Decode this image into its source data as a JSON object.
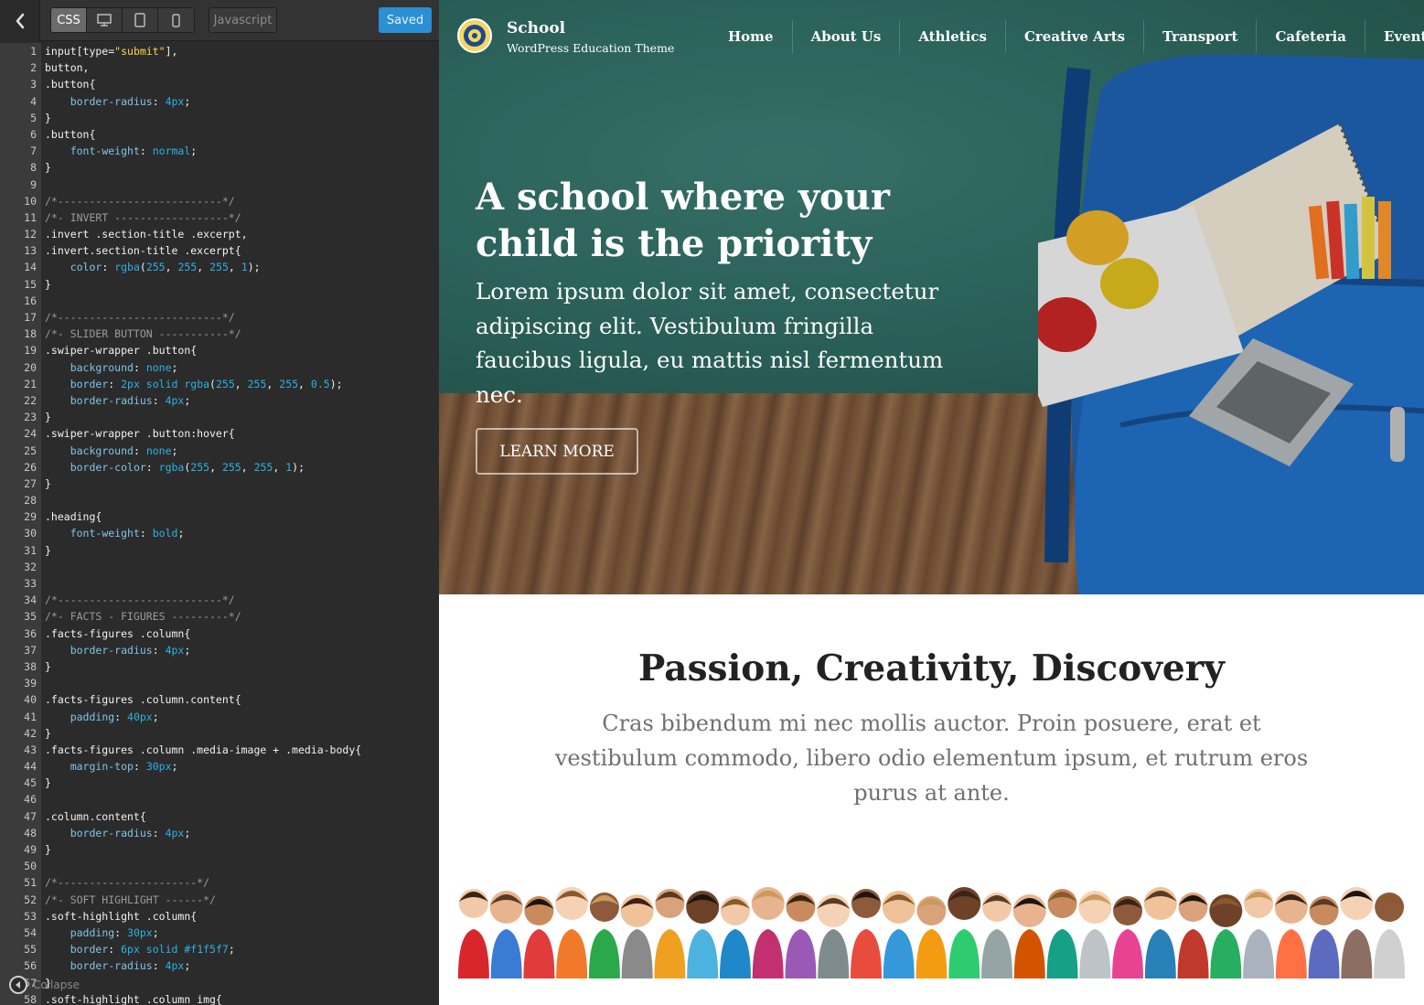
{
  "editor": {
    "tabs": {
      "css": "CSS",
      "javascript": "Javascript"
    },
    "saved_label": "Saved",
    "collapse_label": "Collapse",
    "code_lines": [
      [
        [
          "p",
          "input[type="
        ],
        [
          "s",
          "\"submit\""
        ],
        [
          "p",
          "],"
        ]
      ],
      [
        [
          "p",
          "button,"
        ]
      ],
      [
        [
          "p",
          ".button{"
        ]
      ],
      [
        [
          "p",
          "    "
        ],
        [
          "k",
          "border-radius"
        ],
        [
          "p",
          ": "
        ],
        [
          "v",
          "4px"
        ],
        [
          "p",
          ";"
        ]
      ],
      [
        [
          "p",
          "}"
        ]
      ],
      [
        [
          "p",
          ".button{"
        ]
      ],
      [
        [
          "p",
          "    "
        ],
        [
          "k",
          "font-weight"
        ],
        [
          "p",
          ": "
        ],
        [
          "v",
          "normal"
        ],
        [
          "p",
          ";"
        ]
      ],
      [
        [
          "p",
          "}"
        ]
      ],
      [],
      [
        [
          "c",
          "/*--------------------------*/"
        ]
      ],
      [
        [
          "c",
          "/*- INVERT ------------------*/"
        ]
      ],
      [
        [
          "p",
          ".invert .section-title .excerpt,"
        ]
      ],
      [
        [
          "p",
          ".invert.section-title .excerpt{"
        ]
      ],
      [
        [
          "p",
          "    "
        ],
        [
          "k",
          "color"
        ],
        [
          "p",
          ": "
        ],
        [
          "v",
          "rgba"
        ],
        [
          "p",
          "("
        ],
        [
          "v",
          "255"
        ],
        [
          "p",
          ", "
        ],
        [
          "v",
          "255"
        ],
        [
          "p",
          ", "
        ],
        [
          "v",
          "255"
        ],
        [
          "p",
          ", "
        ],
        [
          "v",
          "1"
        ],
        [
          "p",
          ");"
        ]
      ],
      [
        [
          "p",
          "}"
        ]
      ],
      [],
      [
        [
          "c",
          "/*--------------------------*/"
        ]
      ],
      [
        [
          "c",
          "/*- SLIDER BUTTON -----------*/"
        ]
      ],
      [
        [
          "p",
          ".swiper-wrapper .button{"
        ]
      ],
      [
        [
          "p",
          "    "
        ],
        [
          "k",
          "background"
        ],
        [
          "p",
          ": "
        ],
        [
          "v",
          "none"
        ],
        [
          "p",
          ";"
        ]
      ],
      [
        [
          "p",
          "    "
        ],
        [
          "k",
          "border"
        ],
        [
          "p",
          ": "
        ],
        [
          "v",
          "2px solid rgba"
        ],
        [
          "p",
          "("
        ],
        [
          "v",
          "255"
        ],
        [
          "p",
          ", "
        ],
        [
          "v",
          "255"
        ],
        [
          "p",
          ", "
        ],
        [
          "v",
          "255"
        ],
        [
          "p",
          ", "
        ],
        [
          "v",
          "0.5"
        ],
        [
          "p",
          ");"
        ]
      ],
      [
        [
          "p",
          "    "
        ],
        [
          "k",
          "border-radius"
        ],
        [
          "p",
          ": "
        ],
        [
          "v",
          "4px"
        ],
        [
          "p",
          ";"
        ]
      ],
      [
        [
          "p",
          "}"
        ]
      ],
      [
        [
          "p",
          ".swiper-wrapper .button:hover{"
        ]
      ],
      [
        [
          "p",
          "    "
        ],
        [
          "k",
          "background"
        ],
        [
          "p",
          ": "
        ],
        [
          "v",
          "none"
        ],
        [
          "p",
          ";"
        ]
      ],
      [
        [
          "p",
          "    "
        ],
        [
          "k",
          "border-color"
        ],
        [
          "p",
          ": "
        ],
        [
          "v",
          "rgba"
        ],
        [
          "p",
          "("
        ],
        [
          "v",
          "255"
        ],
        [
          "p",
          ", "
        ],
        [
          "v",
          "255"
        ],
        [
          "p",
          ", "
        ],
        [
          "v",
          "255"
        ],
        [
          "p",
          ", "
        ],
        [
          "v",
          "1"
        ],
        [
          "p",
          ");"
        ]
      ],
      [
        [
          "p",
          "}"
        ]
      ],
      [],
      [
        [
          "p",
          ".heading{"
        ]
      ],
      [
        [
          "p",
          "    "
        ],
        [
          "k",
          "font-weight"
        ],
        [
          "p",
          ": "
        ],
        [
          "v",
          "bold"
        ],
        [
          "p",
          ";"
        ]
      ],
      [
        [
          "p",
          "}"
        ]
      ],
      [],
      [],
      [
        [
          "c",
          "/*--------------------------*/"
        ]
      ],
      [
        [
          "c",
          "/*- FACTS - FIGURES ---------*/"
        ]
      ],
      [
        [
          "p",
          ".facts-figures .column{"
        ]
      ],
      [
        [
          "p",
          "    "
        ],
        [
          "k",
          "border-radius"
        ],
        [
          "p",
          ": "
        ],
        [
          "v",
          "4px"
        ],
        [
          "p",
          ";"
        ]
      ],
      [
        [
          "p",
          "}"
        ]
      ],
      [],
      [
        [
          "p",
          ".facts-figures .column.content{"
        ]
      ],
      [
        [
          "p",
          "    "
        ],
        [
          "k",
          "padding"
        ],
        [
          "p",
          ": "
        ],
        [
          "v",
          "40px"
        ],
        [
          "p",
          ";"
        ]
      ],
      [
        [
          "p",
          "}"
        ]
      ],
      [
        [
          "p",
          ".facts-figures .column .media-image + .media-body{"
        ]
      ],
      [
        [
          "p",
          "    "
        ],
        [
          "k",
          "margin-top"
        ],
        [
          "p",
          ": "
        ],
        [
          "v",
          "30px"
        ],
        [
          "p",
          ";"
        ]
      ],
      [
        [
          "p",
          "}"
        ]
      ],
      [],
      [
        [
          "p",
          ".column.content{"
        ]
      ],
      [
        [
          "p",
          "    "
        ],
        [
          "k",
          "border-radius"
        ],
        [
          "p",
          ": "
        ],
        [
          "v",
          "4px"
        ],
        [
          "p",
          ";"
        ]
      ],
      [
        [
          "p",
          "}"
        ]
      ],
      [],
      [
        [
          "c",
          "/*----------------------*/"
        ]
      ],
      [
        [
          "c",
          "/*- SOFT HIGHLIGHT ------*/"
        ]
      ],
      [
        [
          "p",
          ".soft-highlight .column{"
        ]
      ],
      [
        [
          "p",
          "    "
        ],
        [
          "k",
          "padding"
        ],
        [
          "p",
          ": "
        ],
        [
          "v",
          "30px"
        ],
        [
          "p",
          ";"
        ]
      ],
      [
        [
          "p",
          "    "
        ],
        [
          "k",
          "border"
        ],
        [
          "p",
          ": "
        ],
        [
          "v",
          "6px solid #f1f5f7"
        ],
        [
          "p",
          ";"
        ]
      ],
      [
        [
          "p",
          "    "
        ],
        [
          "k",
          "border-radius"
        ],
        [
          "p",
          ": "
        ],
        [
          "v",
          "4px"
        ],
        [
          "p",
          ";"
        ]
      ],
      [
        [
          "p",
          "}"
        ]
      ],
      [
        [
          "p",
          ".soft-highlight .column img{"
        ]
      ]
    ]
  },
  "site": {
    "title": "School",
    "tagline": "WordPress Education Theme",
    "nav": [
      "Home",
      "About Us",
      "Athletics",
      "Creative Arts",
      "Transport",
      "Cafeteria",
      "Events"
    ],
    "hero": {
      "title": "A school where your child is the priority",
      "excerpt": "Lorem ipsum dolor sit amet, consectetur adipiscing elit. Vestibulum fringilla faucibus ligula, eu mattis nisl fermentum nec.",
      "button": "LEARN MORE"
    },
    "intro": {
      "title": "Passion, Creativity, Discovery",
      "excerpt": "Cras bibendum mi nec mollis auctor. Proin posuere, erat et vestibulum commodo, libero odio elementum ipsum, et rutrum eros purus at ante."
    }
  },
  "colors": {
    "editor_bg": "#2b2b2b",
    "saved_button": "#2b8fd3",
    "property": "#7fc4e8",
    "value": "#2bb3e6",
    "string": "#ffd54a",
    "comment": "#9b9b9b",
    "chalkboard": "#2f6c64"
  },
  "icons": {
    "back": "chevron-left-icon",
    "desktop": "desktop-icon",
    "tablet": "tablet-icon",
    "phone": "phone-icon",
    "collapse": "collapse-icon"
  }
}
